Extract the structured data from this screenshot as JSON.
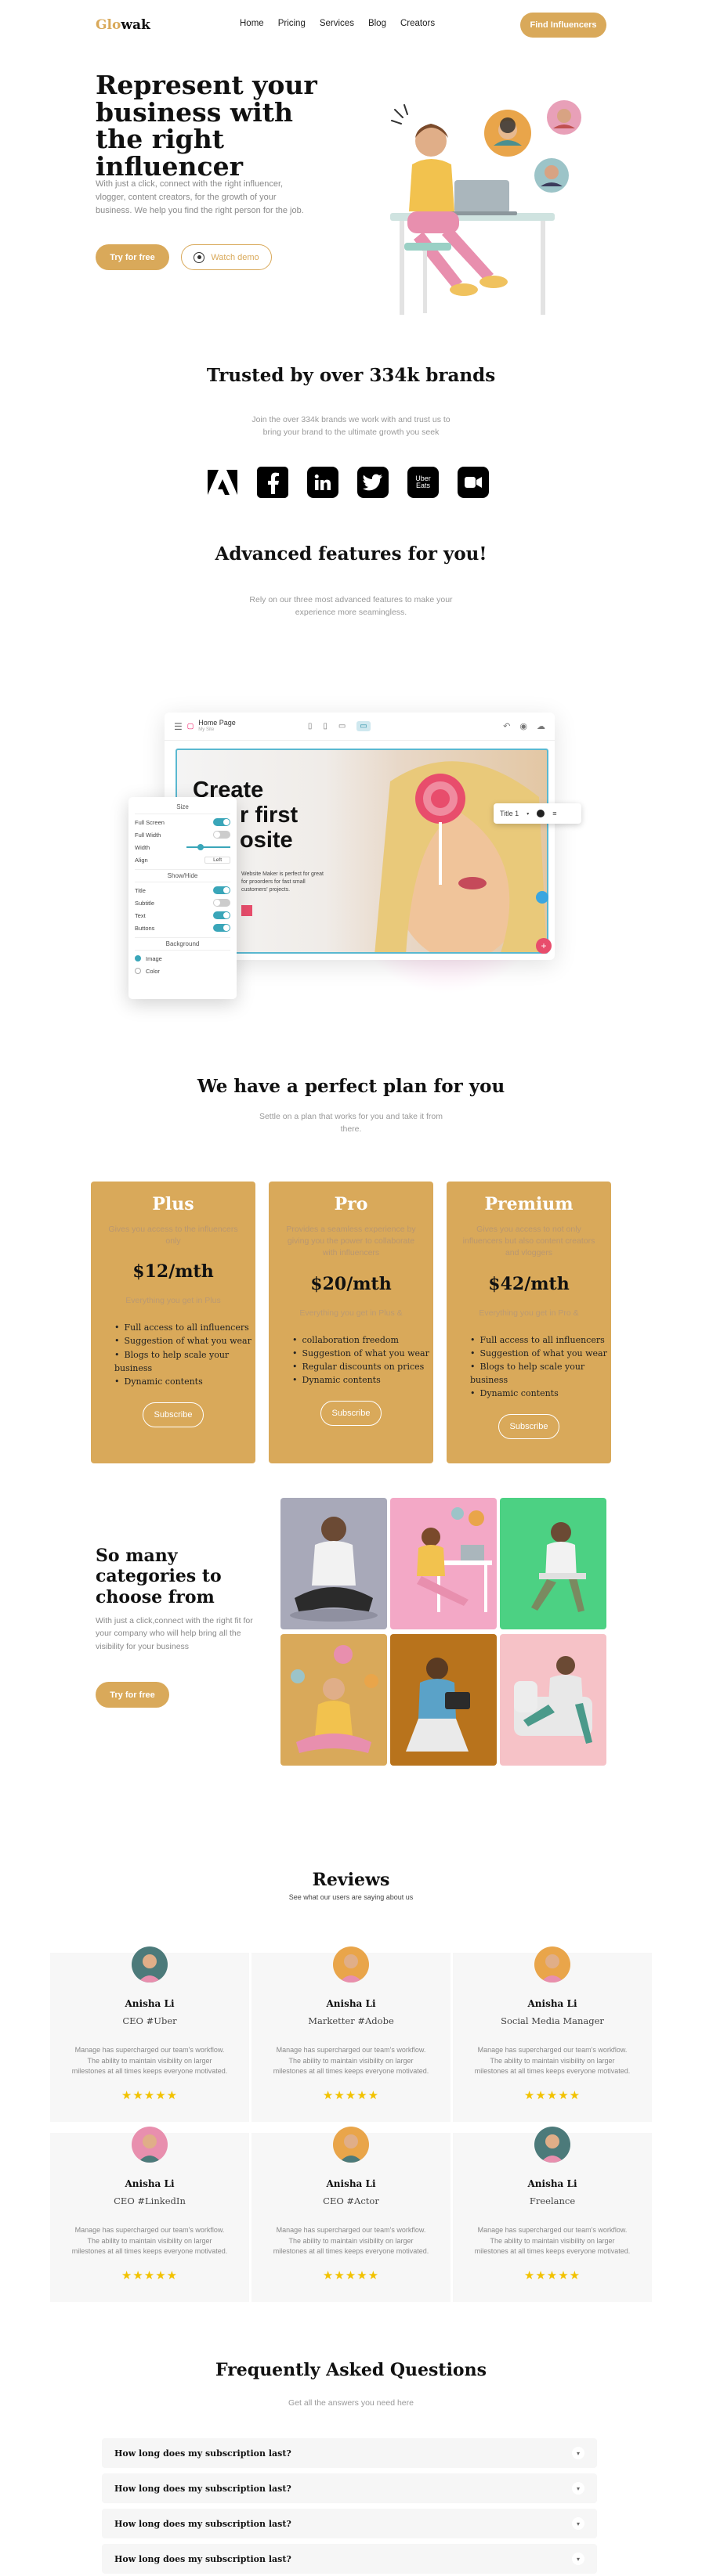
{
  "nav": {
    "logo_a": "Glo",
    "logo_b": "wak",
    "links": [
      "Home",
      "Pricing",
      "Services",
      "Blog",
      "Creators"
    ],
    "cta": "Find Influencers"
  },
  "hero": {
    "title": "Represent your business with the right influencer",
    "desc": "With just a click, connect with the right influencer, vlogger, content creators, for the growth of your business. We help you find the right person for the job.",
    "try_btn": "Try for free",
    "demo_btn": "Watch demo"
  },
  "trusted": {
    "title": "Trusted by over 334k brands",
    "sub1": "Join the over 334k brands we work with and trust us to",
    "sub2": "bring your brand to the ultimate growth you seek",
    "brands": [
      "adobe-logo",
      "facebook-logo",
      "linkedin-logo",
      "twitter-logo",
      "uber-eats-logo",
      "video-logo"
    ],
    "uber_line1": "Uber",
    "uber_line2": "Eats"
  },
  "features": {
    "title": "Advanced features for you!",
    "sub1": "Rely on our three most advanced features to make your",
    "sub2": "experience more seamingless.",
    "mock": {
      "page_title": "Home Page",
      "page_sub": "My Site",
      "headline_1": "Create",
      "headline_2": "r first",
      "headline_3": "osite",
      "body": "Website Maker is perfect for great for proorders for fast small customers' projects.",
      "title_chip": "Title 1",
      "panel_head": "Size",
      "panel_rows": [
        "Full Screen",
        "Full Width",
        "Width",
        "Align"
      ],
      "align_val": "Left",
      "show_hide": "Show/Hide",
      "show_rows": [
        "Title",
        "Subtitle",
        "Text",
        "Buttons"
      ],
      "background": "Background",
      "bg_opts": [
        "Image",
        "Color"
      ]
    }
  },
  "pricing": {
    "title": "We have a perfect plan for you",
    "sub1": "Settle on a plan that works for you and take it from",
    "sub2": "there.",
    "plans": [
      {
        "name": "Plus",
        "desc": "Gives you access to the influencers only",
        "price": "$12/mth",
        "incl": "Everything you get in Plus",
        "features": [
          "Full access to all influencers",
          "Suggestion of what you wear",
          "Blogs to help scale your business",
          "Dynamic contents"
        ],
        "btn": "Subscribe"
      },
      {
        "name": "Pro",
        "desc": "Provides a seamless experience by giving you the power to collaborate with influencers",
        "price": "$20/mth",
        "incl": "Everything you get in Plus &",
        "features": [
          "collaboration freedom",
          "Suggestion of what you wear",
          "Regular discounts on prices",
          "Dynamic contents"
        ],
        "btn": "Subscribe"
      },
      {
        "name": "Premium",
        "desc": "Gives you access to not only influencers but also content creators and vloggers",
        "price": "$42/mth",
        "incl": "Everything you get in Pro &",
        "features": [
          "Full access to all influencers",
          "Suggestion of what you wear",
          "Blogs to help scale your business",
          "Dynamic contents"
        ],
        "btn": "Subscribe"
      }
    ]
  },
  "categories": {
    "title": "So many categories to choose from",
    "desc": "With just a click,connect with the right fit for your company who will help bring all the visibility for your business",
    "btn": "Try for free",
    "tiles": [
      "meditating-person",
      "person-at-desk",
      "person-on-chair",
      "yoga-person-with-avatars",
      "person-with-tablet",
      "person-on-sofa"
    ]
  },
  "reviews": {
    "title": "Reviews",
    "sub": "See what our users are saying about us",
    "items": [
      {
        "name": "Anisha Li",
        "role": "CEO #Uber",
        "text": "Manage has supercharged our team's workflow. The ability to maintain visibility on larger milestones at all times keeps everyone motivated.",
        "stars": "★★★★★"
      },
      {
        "name": "Anisha Li",
        "role": "Marketter #Adobe",
        "text": "Manage has supercharged our team's workflow. The ability to maintain visibility on larger milestones at all times keeps everyone motivated.",
        "stars": "★★★★★"
      },
      {
        "name": "Anisha Li",
        "role": "Social Media Manager",
        "text": "Manage has supercharged our team's workflow. The ability to maintain visibility on larger milestones at all times keeps everyone motivated.",
        "stars": "★★★★★"
      },
      {
        "name": "Anisha Li",
        "role": "CEO #LinkedIn",
        "text": "Manage has supercharged our team's workflow. The ability to maintain visibility on larger milestones at all times keeps everyone motivated.",
        "stars": "★★★★★"
      },
      {
        "name": "Anisha Li",
        "role": "CEO #Actor",
        "text": "Manage has supercharged our team's workflow. The ability to maintain visibility on larger milestones at all times keeps everyone motivated.",
        "stars": "★★★★★"
      },
      {
        "name": "Anisha Li",
        "role": "Freelance",
        "text": "Manage has supercharged our team's workflow. The ability to maintain visibility on larger milestones at all times keeps everyone motivated.",
        "stars": "★★★★★"
      }
    ]
  },
  "faq": {
    "title": "Frequently Asked Questions",
    "sub": "Get all the answers you need here",
    "items": [
      "How long does my subscription last?",
      "How long does my subscription last?",
      "How long does my subscription last?",
      "How long does my subscription last?"
    ]
  },
  "colors": {
    "accent": "#d9a95a",
    "review_bg": "#f7f7f7",
    "star": "#f2c200"
  }
}
